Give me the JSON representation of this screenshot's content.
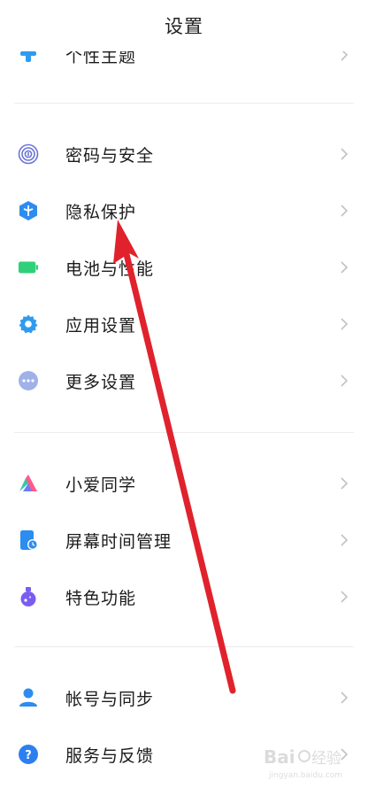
{
  "header": {
    "title": "设置"
  },
  "items": [
    {
      "label": "个性主题",
      "icon": "brush-icon"
    },
    {
      "label": "密码与安全",
      "icon": "fingerprint-icon"
    },
    {
      "label": "隐私保护",
      "icon": "privacy-shield-icon"
    },
    {
      "label": "电池与性能",
      "icon": "battery-icon"
    },
    {
      "label": "应用设置",
      "icon": "gear-icon"
    },
    {
      "label": "更多设置",
      "icon": "more-dots-icon"
    },
    {
      "label": "小爱同学",
      "icon": "xiaoai-icon"
    },
    {
      "label": "屏幕时间管理",
      "icon": "screen-time-icon"
    },
    {
      "label": "特色功能",
      "icon": "flask-icon"
    },
    {
      "label": "帐号与同步",
      "icon": "person-icon"
    },
    {
      "label": "服务与反馈",
      "icon": "help-icon"
    }
  ],
  "annotation": {
    "type": "red-arrow",
    "color": "#e0222c",
    "points_to": "隐私保护"
  },
  "watermark": {
    "text": "Bai 经验",
    "sub": "jingyan.baidu.com"
  },
  "colors": {
    "fingerprint": "#6c74d6",
    "privacy": "#2d8cf0",
    "battery": "#2fd079",
    "gear": "#2f9bf0",
    "more": "#9fb2e8",
    "screen_time": "#2c8cf0",
    "flask": "#7a5df0",
    "person": "#2d8cf0",
    "help": "#2d7ff0"
  }
}
